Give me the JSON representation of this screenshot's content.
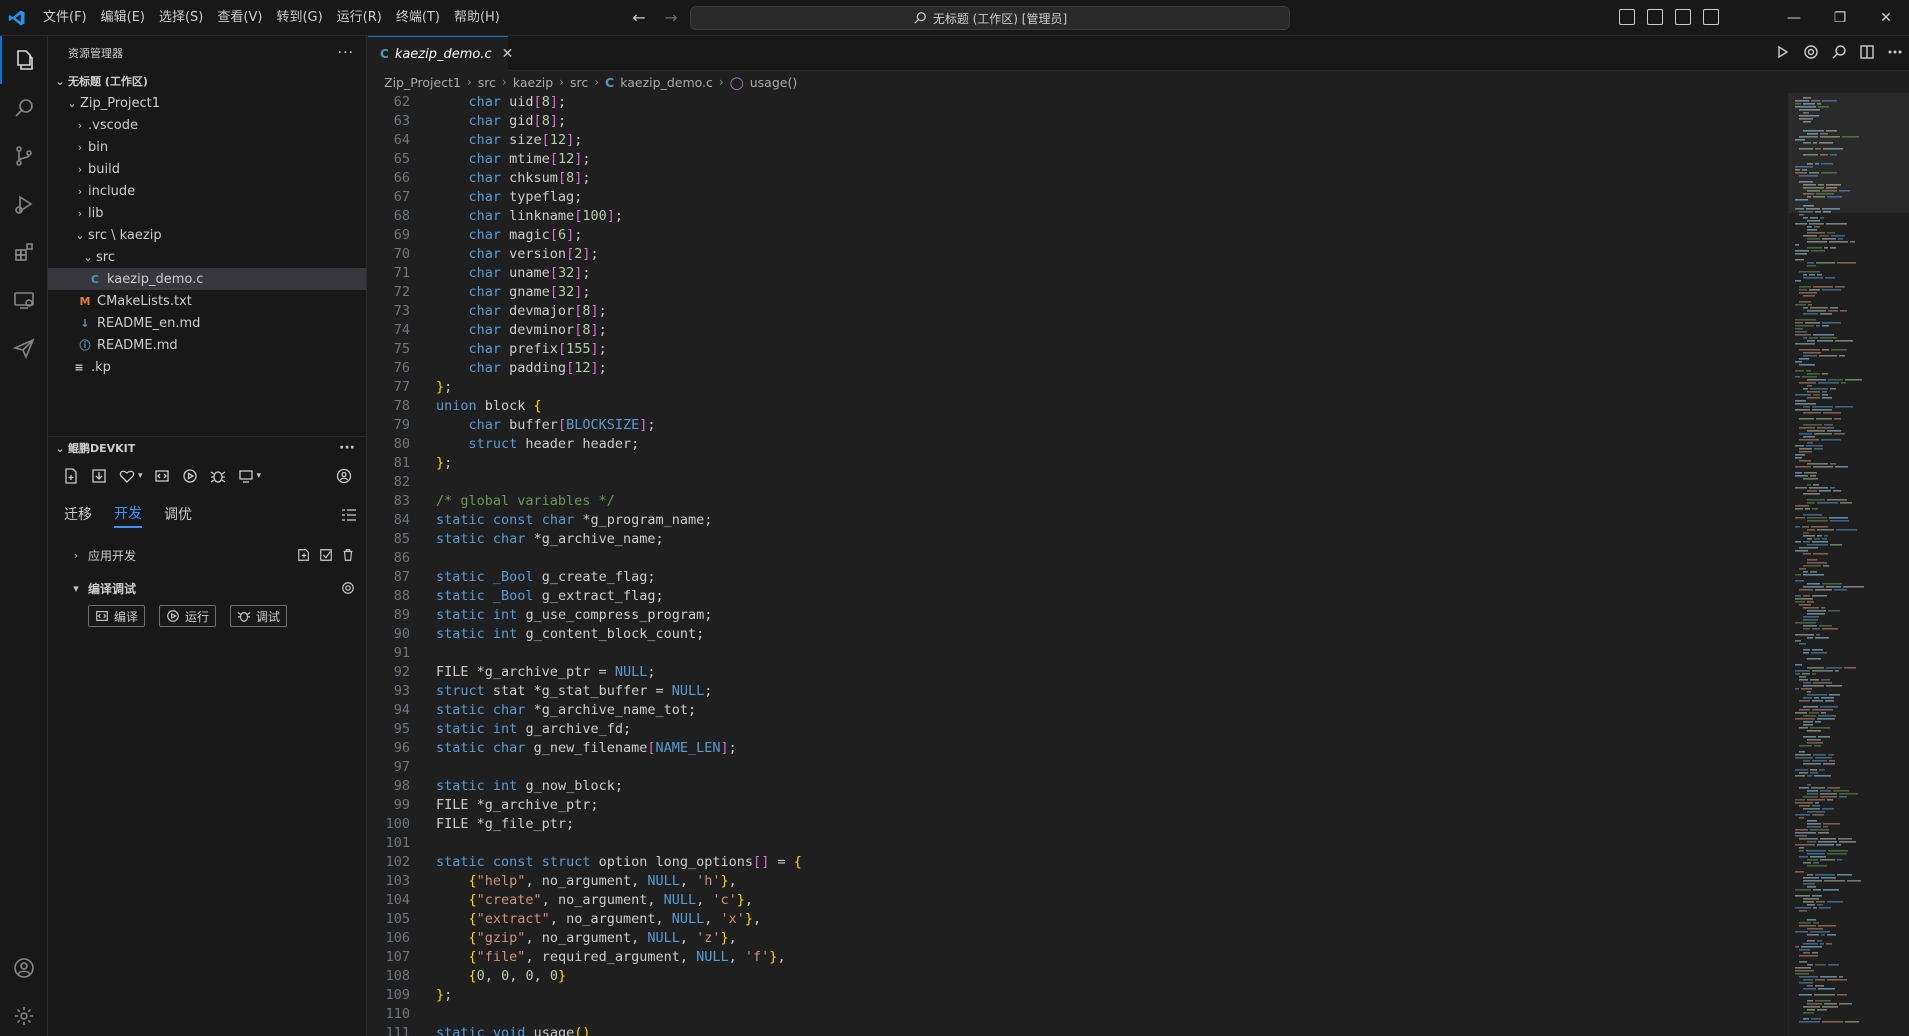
{
  "titlebar": {
    "menus": [
      "文件(F)",
      "编辑(E)",
      "选择(S)",
      "查看(V)",
      "转到(G)",
      "运行(R)",
      "终端(T)",
      "帮助(H)"
    ],
    "search_text": "无标题 (工作区) [管理员]"
  },
  "sidebar": {
    "title": "资源管理器",
    "workspace": "无标题 (工作区)",
    "project": "Zip_Project1",
    "folders": [
      ".vscode",
      "bin",
      "build",
      "include",
      "lib"
    ],
    "src_kaezip": "src \\ kaezip",
    "src": "src",
    "active_file": "kaezip_demo.c",
    "files": [
      "CMakeLists.txt",
      "README_en.md",
      "README.md",
      ".kp"
    ]
  },
  "devkit": {
    "title": "鲲鹏DEVKIT",
    "tabs": [
      "迁移",
      "开发",
      "调优"
    ],
    "active_tab": "开发",
    "app_dev": "应用开发",
    "compile_debug": "编译调试",
    "buttons": [
      "编译",
      "运行",
      "调试"
    ]
  },
  "editor": {
    "tab_label": "kaezip_demo.c",
    "breadcrumb": [
      "Zip_Project1",
      "src",
      "kaezip",
      "src",
      "kaezip_demo.c",
      "usage()"
    ]
  },
  "code_lines": [
    {
      "n": "62",
      "t": "    char uid[8];"
    },
    {
      "n": "63",
      "t": "    char gid[8];"
    },
    {
      "n": "64",
      "t": "    char size[12];"
    },
    {
      "n": "65",
      "t": "    char mtime[12];"
    },
    {
      "n": "66",
      "t": "    char chksum[8];"
    },
    {
      "n": "67",
      "t": "    char typeflag;"
    },
    {
      "n": "68",
      "t": "    char linkname[100];"
    },
    {
      "n": "69",
      "t": "    char magic[6];"
    },
    {
      "n": "70",
      "t": "    char version[2];"
    },
    {
      "n": "71",
      "t": "    char uname[32];"
    },
    {
      "n": "72",
      "t": "    char gname[32];"
    },
    {
      "n": "73",
      "t": "    char devmajor[8];"
    },
    {
      "n": "74",
      "t": "    char devminor[8];"
    },
    {
      "n": "75",
      "t": "    char prefix[155];"
    },
    {
      "n": "76",
      "t": "    char padding[12];"
    },
    {
      "n": "77",
      "t": "};"
    },
    {
      "n": "78",
      "t": "union block {"
    },
    {
      "n": "79",
      "t": "    char buffer[BLOCKSIZE];"
    },
    {
      "n": "80",
      "t": "    struct header header;"
    },
    {
      "n": "81",
      "t": "};"
    },
    {
      "n": "82",
      "t": ""
    },
    {
      "n": "83",
      "t": "/* global variables */"
    },
    {
      "n": "84",
      "t": "static const char *g_program_name;"
    },
    {
      "n": "85",
      "t": "static char *g_archive_name;"
    },
    {
      "n": "86",
      "t": ""
    },
    {
      "n": "87",
      "t": "static _Bool g_create_flag;"
    },
    {
      "n": "88",
      "t": "static _Bool g_extract_flag;"
    },
    {
      "n": "89",
      "t": "static int g_use_compress_program;"
    },
    {
      "n": "90",
      "t": "static int g_content_block_count;"
    },
    {
      "n": "91",
      "t": ""
    },
    {
      "n": "92",
      "t": "FILE *g_archive_ptr = NULL;"
    },
    {
      "n": "93",
      "t": "struct stat *g_stat_buffer = NULL;"
    },
    {
      "n": "94",
      "t": "static char *g_archive_name_tot;"
    },
    {
      "n": "95",
      "t": "static int g_archive_fd;"
    },
    {
      "n": "96",
      "t": "static char g_new_filename[NAME_LEN];"
    },
    {
      "n": "97",
      "t": ""
    },
    {
      "n": "98",
      "t": "static int g_now_block;"
    },
    {
      "n": "99",
      "t": "FILE *g_archive_ptr;"
    },
    {
      "n": "100",
      "t": "FILE *g_file_ptr;"
    },
    {
      "n": "101",
      "t": ""
    },
    {
      "n": "102",
      "t": "static const struct option long_options[] = {"
    },
    {
      "n": "103",
      "t": "    {\"help\", no_argument, NULL, 'h'},"
    },
    {
      "n": "104",
      "t": "    {\"create\", no_argument, NULL, 'c'},"
    },
    {
      "n": "105",
      "t": "    {\"extract\", no_argument, NULL, 'x'},"
    },
    {
      "n": "106",
      "t": "    {\"gzip\", no_argument, NULL, 'z'},"
    },
    {
      "n": "107",
      "t": "    {\"file\", required_argument, NULL, 'f'},"
    },
    {
      "n": "108",
      "t": "    {0, 0, 0, 0}"
    },
    {
      "n": "109",
      "t": "};"
    },
    {
      "n": "110",
      "t": ""
    },
    {
      "n": "111",
      "t": "static void usage()"
    }
  ],
  "colors": {
    "accent": "#0078d4",
    "keyword": "#569cd6",
    "number": "#b5cea8",
    "string": "#ce9178",
    "comment": "#6a9955"
  }
}
